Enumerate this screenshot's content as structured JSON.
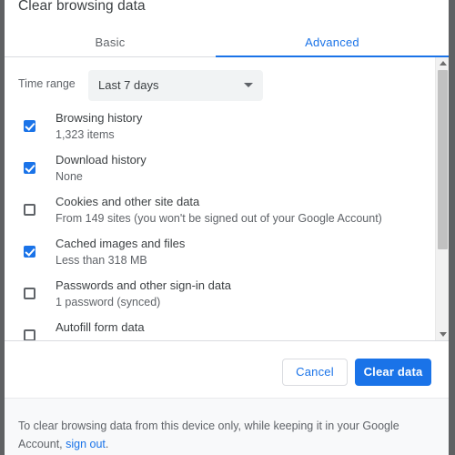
{
  "dialog": {
    "title": "Clear browsing data"
  },
  "tabs": [
    {
      "label": "Basic",
      "active": false
    },
    {
      "label": "Advanced",
      "active": true
    }
  ],
  "time_range": {
    "label": "Time range",
    "selected": "Last 7 days",
    "caret_icon": "chevron-down-icon"
  },
  "options": [
    {
      "title": "Browsing history",
      "subtitle": "1,323 items",
      "checked": true
    },
    {
      "title": "Download history",
      "subtitle": "None",
      "checked": true
    },
    {
      "title": "Cookies and other site data",
      "subtitle": "From 149 sites (you won't be signed out of your Google Account)",
      "checked": false
    },
    {
      "title": "Cached images and files",
      "subtitle": "Less than 318 MB",
      "checked": true
    },
    {
      "title": "Passwords and other sign-in data",
      "subtitle": "1 password (synced)",
      "checked": false
    },
    {
      "title": "Autofill form data",
      "subtitle": "",
      "checked": false
    }
  ],
  "scrollbar": {
    "up_arrow_icon": "scroll-up-arrow-icon",
    "down_arrow_icon": "scroll-down-arrow-icon"
  },
  "actions": {
    "cancel_label": "Cancel",
    "confirm_label": "Clear data"
  },
  "footer": {
    "text_before": "To clear browsing data from this device only, while keeping it in your Google Account, ",
    "link_label": "sign out",
    "text_after": "."
  },
  "colors": {
    "accent_blue": "#1a73e8",
    "text_primary": "#3c4043",
    "text_secondary": "#5f6368",
    "surface": "#ffffff",
    "footer_bg": "#f8f9fa",
    "select_bg": "#f1f3f4",
    "divider": "#dadce0",
    "window_edge": "#5f6163"
  }
}
